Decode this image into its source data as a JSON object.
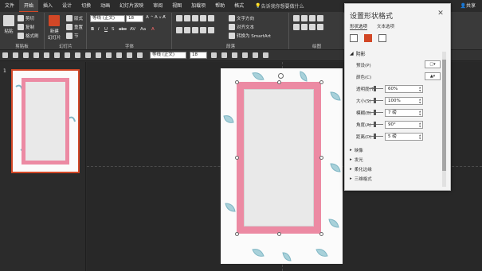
{
  "menu": {
    "tabs": [
      "文件",
      "开始",
      "插入",
      "设计",
      "切换",
      "动画",
      "幻灯片放映",
      "审阅",
      "视图",
      "加载项",
      "帮助",
      "格式"
    ],
    "active_tab": "开始",
    "tell_me": "告诉我你想要做什么",
    "share": "共享"
  },
  "ribbon": {
    "clipboard": {
      "label": "剪贴板",
      "paste": "粘贴",
      "cut": "剪切",
      "copy": "复制",
      "format_painter": "格式刷"
    },
    "slides": {
      "label": "幻灯片",
      "new_slide": "新建\n幻灯片",
      "layout": "版式",
      "reset": "重置",
      "section": "节"
    },
    "font": {
      "label": "字体",
      "font_name": "等线 (正文)",
      "font_size": "18",
      "bold": "B",
      "italic": "I",
      "underline": "U",
      "shadow": "S",
      "strike": "abc",
      "spacing": "AV",
      "case": "Aa",
      "color": "A"
    },
    "paragraph": {
      "label": "段落",
      "text_direction": "文字方向",
      "align_text": "对齐文本",
      "smartart": "转换为 SmartArt"
    },
    "drawing": {
      "label": "绘图"
    }
  },
  "qat": {
    "font_name": "等线 (正文)",
    "font_size": "18"
  },
  "thumbnails": {
    "slide_number": "1"
  },
  "pane": {
    "title": "设置形状格式",
    "tab_shape": "形状选项",
    "tab_text": "文本选项",
    "shadow_section": "阴影",
    "rows": [
      {
        "label": "预设(P)",
        "value": ""
      },
      {
        "label": "颜色(C)",
        "value": ""
      },
      {
        "label": "透明度(T)",
        "value": "60%"
      },
      {
        "label": "大小(S)",
        "value": "100%"
      },
      {
        "label": "模糊(B)",
        "value": "7 磅"
      },
      {
        "label": "角度(A)",
        "value": "90°"
      },
      {
        "label": "距离(D)",
        "value": "5 磅"
      }
    ],
    "collapsed": [
      "映像",
      "发光",
      "柔化边缘",
      "三维格式"
    ]
  },
  "colors": {
    "accent": "#d24726",
    "frame_pink": "#ec8aa3",
    "leaf": "#7fb6c4"
  }
}
